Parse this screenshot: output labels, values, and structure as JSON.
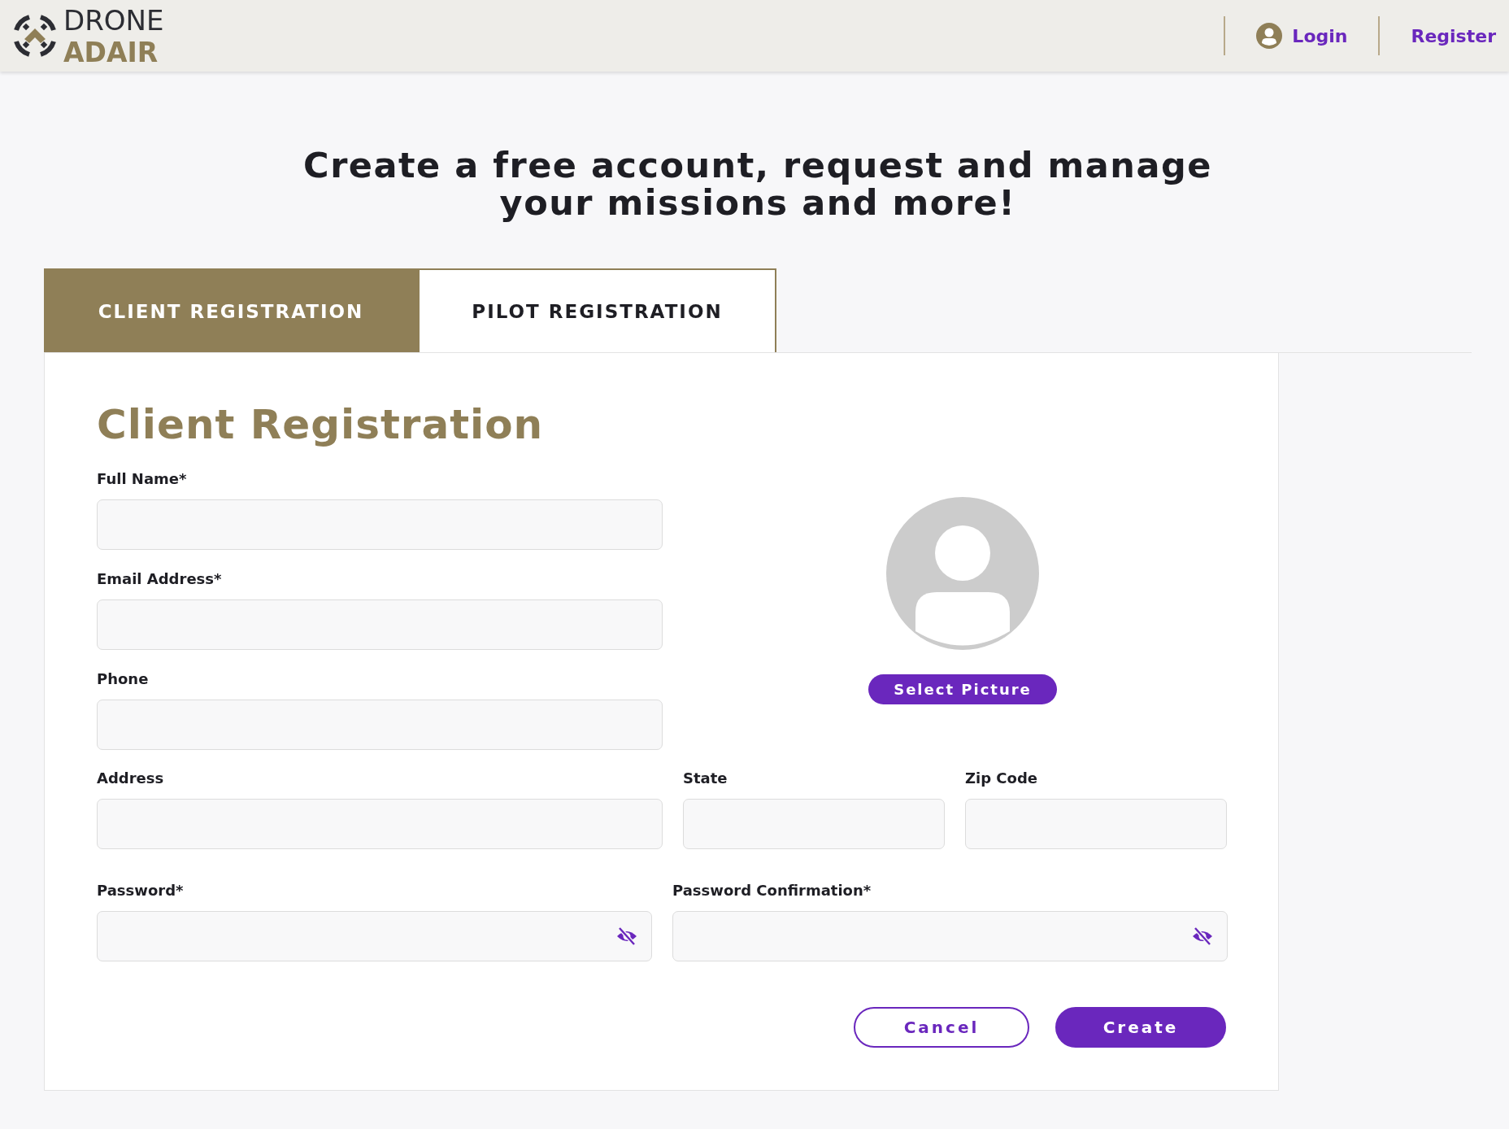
{
  "header": {
    "logo": {
      "top": "DRONE",
      "bottom": "ADAIR"
    },
    "nav": [
      {
        "label": "Login",
        "kind": "account"
      },
      {
        "label": "Register",
        "kind": "plain"
      }
    ]
  },
  "headline": [
    "Create a free account, request and manage",
    "your missions and more!"
  ],
  "tabs": [
    {
      "label": "CLIENT REGISTRATION",
      "selected": true
    },
    {
      "label": "PILOT REGISTRATION",
      "selected": false
    }
  ],
  "form": {
    "title": "Client Registration",
    "personal_fields": [
      {
        "label": "Full Name*",
        "kind": "text"
      },
      {
        "label": "Email Address*",
        "kind": "text"
      },
      {
        "label": "Phone",
        "kind": "text"
      }
    ],
    "picture_button": "Select Picture",
    "address_fields": [
      {
        "label": "Address",
        "kind": "text"
      },
      {
        "label": "State",
        "kind": "text"
      },
      {
        "label": "Zip Code",
        "kind": "text"
      }
    ],
    "password_fields": [
      {
        "label": "Password*",
        "kind": "password"
      },
      {
        "label": "Password Confirmation*",
        "kind": "password"
      }
    ],
    "buttons": [
      {
        "label": "Cancel",
        "kind": "secondary"
      },
      {
        "label": "Create",
        "kind": "primary"
      }
    ]
  }
}
